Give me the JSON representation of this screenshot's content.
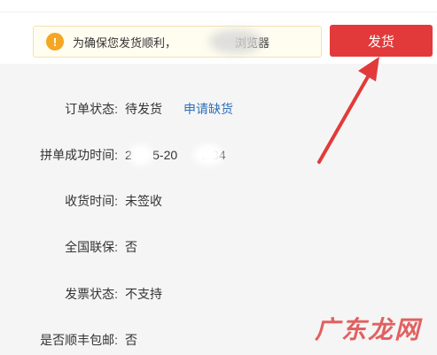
{
  "notice": {
    "text_before": "为确保您发货顺利，",
    "text_after": "浏览器",
    "icon": "warning-icon"
  },
  "actions": {
    "ship_label": "发货"
  },
  "details": {
    "order_status": {
      "label": "订单状态:",
      "value": "待发货",
      "link": "申请缺货"
    },
    "group_time": {
      "label": "拼单成功时间:",
      "value": "2      5-20       2:34"
    },
    "receipt_time": {
      "label": "收货时间:",
      "value": "未签收"
    },
    "national_guarantee": {
      "label": "全国联保:",
      "value": "否"
    },
    "invoice_status": {
      "label": "发票状态:",
      "value": "不支持"
    },
    "sf_free_shipping": {
      "label": "是否顺丰包邮:",
      "value": "否"
    }
  },
  "watermark": {
    "text": "广东龙网"
  },
  "colors": {
    "accent": "#e23a3a",
    "link": "#2f6fb6",
    "warning": "#f5a623",
    "panel": "#f5f5f5"
  }
}
